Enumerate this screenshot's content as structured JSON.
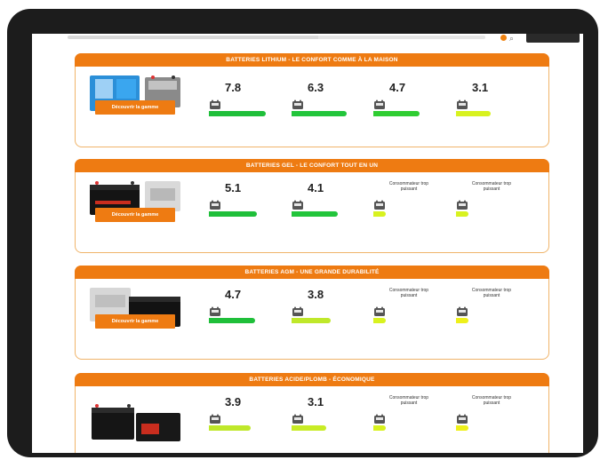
{
  "header": {
    "button_label": "",
    "colors": {
      "accent": "#ee7b12",
      "border": "#f0b46a",
      "bar_green": "#1ec51e",
      "bar_yellow": "#e6ef1a"
    }
  },
  "sections": [
    {
      "title": "BATTERIES LITHIUM - LE CONFORT COMME À LA MAISON",
      "button": "Découvrir la gamme",
      "metrics": [
        {
          "value": "7.8",
          "level": 1.0,
          "color": "#1fbf3a"
        },
        {
          "value": "6.3",
          "level": 0.95,
          "color": "#22c53b"
        },
        {
          "value": "4.7",
          "level": 0.75,
          "color": "#2fcd32"
        },
        {
          "value": "3.1",
          "level": 0.5,
          "color": "#d8f21f"
        }
      ]
    },
    {
      "title": "BATTERIES GEL - LE CONFORT TOUT EN UN",
      "button": "Découvrir la gamme",
      "metrics": [
        {
          "value": "5.1",
          "level": 0.8,
          "color": "#1fbf3a"
        },
        {
          "value": "4.1",
          "level": 0.75,
          "color": "#22c53b"
        },
        {
          "note": "Consommateur trop puissant",
          "level": 0,
          "color": "#d8f21f"
        },
        {
          "note": "Consommateur trop puissant",
          "level": 0,
          "color": "#d8f21f"
        }
      ]
    },
    {
      "title": "BATTERIES AGM - UNE GRANDE DURABILITÉ",
      "button": "Découvrir la gamme",
      "metrics": [
        {
          "value": "4.7",
          "level": 0.75,
          "color": "#1fbf3a"
        },
        {
          "value": "3.8",
          "level": 0.6,
          "color": "#bfe82a"
        },
        {
          "note": "Consommateur trop puissant",
          "level": 0,
          "color": "#d8f21f"
        },
        {
          "note": "Consommateur trop puissant",
          "level": 0,
          "color": "#eef01a"
        }
      ]
    },
    {
      "title": "BATTERIES ACIDE/PLOMB - ÉCONOMIQUE",
      "button": "",
      "metrics": [
        {
          "value": "3.9",
          "level": 0.65,
          "color": "#bfe82a"
        },
        {
          "value": "3.1",
          "level": 0.5,
          "color": "#c8ec25"
        },
        {
          "note": "Consommateur trop puissant",
          "level": 0,
          "color": "#d8f21f"
        },
        {
          "note": "Consommateur trop puissant",
          "level": 0,
          "color": "#eef01a"
        }
      ]
    }
  ]
}
